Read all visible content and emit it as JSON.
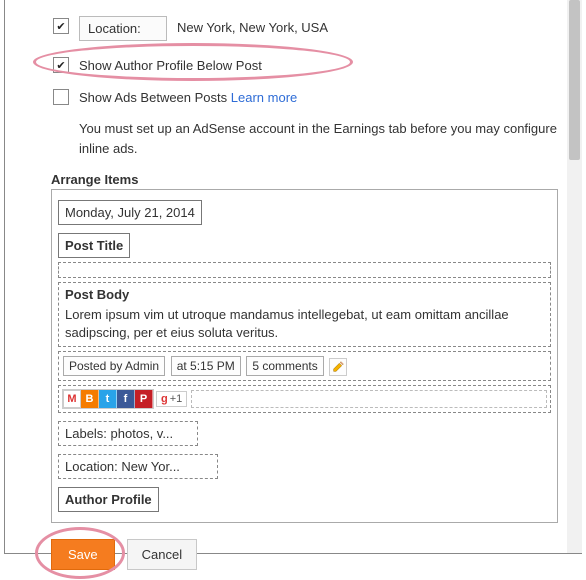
{
  "options": {
    "location_label": "Location:",
    "location_value": "New York, New York, USA",
    "author_profile_label": "Show Author Profile Below Post",
    "ads_label": "Show Ads Between Posts",
    "ads_learn_more": "Learn more",
    "ads_help": "You must set up an AdSense account in the Earnings tab before you may configure inline ads."
  },
  "arrange": {
    "title": "Arrange Items",
    "date": "Monday, July 21, 2014",
    "post_title": "Post Title",
    "post_body_label": "Post Body",
    "post_body_text": "Lorem ipsum vim ut utroque mandamus intellegebat, ut eam omittam ancillae sadipscing, per et eius soluta veritus.",
    "posted_by": "Posted by Admin",
    "time": "at 5:15 PM",
    "comments": "5 comments",
    "labels": "Labels: photos, v...",
    "location": "Location: New Yor...",
    "author_profile": "Author Profile",
    "share_plus": "+1"
  },
  "actions": {
    "save": "Save",
    "cancel": "Cancel"
  }
}
